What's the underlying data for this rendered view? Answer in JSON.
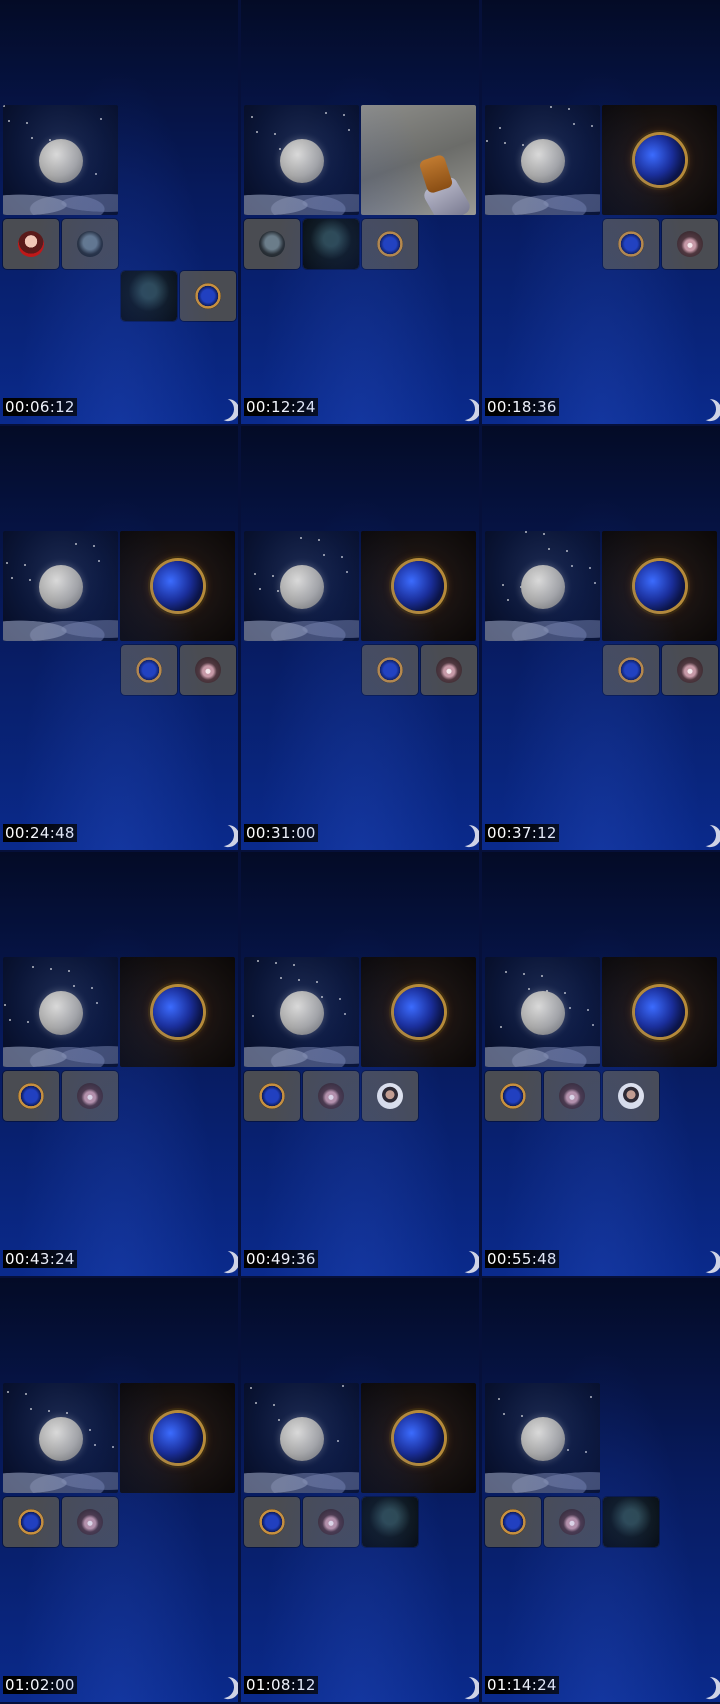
{
  "panels": [
    {
      "timestamp": "00:06:12",
      "tiles": [
        {
          "kind": "moon",
          "size": "big",
          "pos": "b0"
        },
        {
          "kind": "pink-red avatar woman",
          "size": "small",
          "pos": "s0"
        },
        {
          "kind": "helmet avatar",
          "size": "small",
          "pos": "s1"
        },
        {
          "kind": "dark avatar",
          "size": "small",
          "pos": "s2b"
        },
        {
          "kind": "emblem avatar",
          "size": "small",
          "pos": "s3b"
        }
      ]
    },
    {
      "timestamp": "00:12:24",
      "tiles": [
        {
          "kind": "moon",
          "size": "big",
          "pos": "b0"
        },
        {
          "kind": "street video",
          "size": "big",
          "pos": "b1"
        },
        {
          "kind": "helmet avatar",
          "size": "small",
          "pos": "s0"
        },
        {
          "kind": "dark avatar",
          "size": "small",
          "pos": "s1"
        },
        {
          "kind": "emblem avatar",
          "size": "small",
          "pos": "s2"
        }
      ]
    },
    {
      "timestamp": "00:18:36",
      "tiles": [
        {
          "kind": "moon",
          "size": "big",
          "pos": "b0"
        },
        {
          "kind": "sorcery emblem",
          "size": "big",
          "pos": "b1"
        },
        {
          "kind": "emblem avatar",
          "size": "small",
          "pos": "s2"
        },
        {
          "kind": "pink avatar",
          "size": "small",
          "pos": "s3"
        }
      ]
    },
    {
      "timestamp": "00:24:48",
      "tiles": [
        {
          "kind": "moon",
          "size": "big",
          "pos": "b0"
        },
        {
          "kind": "sorcery emblem",
          "size": "big",
          "pos": "b1"
        },
        {
          "kind": "emblem avatar",
          "size": "small",
          "pos": "s2"
        },
        {
          "kind": "pink avatar",
          "size": "small",
          "pos": "s3"
        }
      ]
    },
    {
      "timestamp": "00:31:00",
      "tiles": [
        {
          "kind": "moon",
          "size": "big",
          "pos": "b0"
        },
        {
          "kind": "sorcery emblem",
          "size": "big",
          "pos": "b1"
        },
        {
          "kind": "emblem avatar",
          "size": "small",
          "pos": "s2"
        },
        {
          "kind": "pink avatar",
          "size": "small",
          "pos": "s3"
        }
      ]
    },
    {
      "timestamp": "00:37:12",
      "tiles": [
        {
          "kind": "moon",
          "size": "big",
          "pos": "b0"
        },
        {
          "kind": "sorcery emblem",
          "size": "big",
          "pos": "b1"
        },
        {
          "kind": "emblem avatar",
          "size": "small",
          "pos": "s2"
        },
        {
          "kind": "pink avatar",
          "size": "small",
          "pos": "s3"
        }
      ]
    },
    {
      "timestamp": "00:43:24",
      "tiles": [
        {
          "kind": "moon",
          "size": "big",
          "pos": "b0"
        },
        {
          "kind": "sorcery emblem",
          "size": "big",
          "pos": "b1"
        },
        {
          "kind": "emblem avatar",
          "size": "small",
          "pos": "s0"
        },
        {
          "kind": "pink avatar",
          "size": "small",
          "pos": "s1"
        }
      ]
    },
    {
      "timestamp": "00:49:36",
      "tiles": [
        {
          "kind": "moon",
          "size": "big",
          "pos": "b0"
        },
        {
          "kind": "sorcery emblem",
          "size": "big",
          "pos": "b1"
        },
        {
          "kind": "emblem avatar",
          "size": "small",
          "pos": "s0"
        },
        {
          "kind": "pink avatar",
          "size": "small",
          "pos": "s1"
        },
        {
          "kind": "hijab avatar",
          "size": "small",
          "pos": "s2"
        }
      ]
    },
    {
      "timestamp": "00:55:48",
      "tiles": [
        {
          "kind": "moon",
          "size": "big",
          "pos": "b0"
        },
        {
          "kind": "sorcery emblem",
          "size": "big",
          "pos": "b1"
        },
        {
          "kind": "emblem avatar",
          "size": "small",
          "pos": "s0"
        },
        {
          "kind": "pink avatar",
          "size": "small",
          "pos": "s1"
        },
        {
          "kind": "hijab avatar",
          "size": "small",
          "pos": "s2"
        }
      ]
    },
    {
      "timestamp": "01:02:00",
      "tiles": [
        {
          "kind": "moon",
          "size": "big",
          "pos": "b0"
        },
        {
          "kind": "sorcery emblem",
          "size": "big",
          "pos": "b1"
        },
        {
          "kind": "emblem avatar",
          "size": "small",
          "pos": "s0"
        },
        {
          "kind": "pink avatar",
          "size": "small",
          "pos": "s1"
        }
      ]
    },
    {
      "timestamp": "01:08:12",
      "tiles": [
        {
          "kind": "moon",
          "size": "big",
          "pos": "b0"
        },
        {
          "kind": "sorcery emblem",
          "size": "big",
          "pos": "b1"
        },
        {
          "kind": "emblem avatar",
          "size": "small",
          "pos": "s0"
        },
        {
          "kind": "pink avatar",
          "size": "small",
          "pos": "s1"
        },
        {
          "kind": "dark avatar",
          "size": "small",
          "pos": "s2"
        }
      ]
    },
    {
      "timestamp": "01:14:24",
      "tiles": [
        {
          "kind": "moon",
          "size": "big",
          "pos": "b0"
        },
        {
          "kind": "emblem avatar",
          "size": "small",
          "pos": "s0"
        },
        {
          "kind": "pink avatar",
          "size": "small",
          "pos": "s1"
        },
        {
          "kind": "dark avatar",
          "size": "small",
          "pos": "s2"
        }
      ]
    }
  ]
}
